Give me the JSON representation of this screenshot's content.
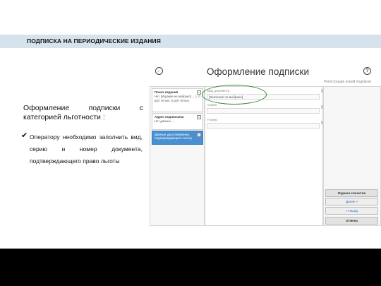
{
  "header": {
    "title": "ПОДПИСКА НА ПЕРИОДИЧЕСКИЕ ИЗДАНИЯ"
  },
  "lead": {
    "text": "Оформление подписки с категорией льготности :"
  },
  "bullet": {
    "text": "Оператору необходимо заполнить вид, серию и номер документа, подтверждающего право льготы"
  },
  "app": {
    "title": "Оформление подписки",
    "registration_label": "Регистрация новой подписки",
    "cards": [
      {
        "title": "Поиск издания",
        "body": "Нет. [Издание не выбрано] ... 1. 0 руб. 00 коп. 0 руб. 00 коп."
      },
      {
        "title": "Адрес подписчика",
        "body": "Нет данных ..."
      },
      {
        "title": "Данные удостоверения, подтверждающего льготу",
        "body": ""
      }
    ],
    "fields": [
      {
        "label": "Вид документа",
        "value": "[Значение не выбрано]"
      },
      {
        "label": "Серия",
        "value": ""
      },
      {
        "label": "Номер",
        "value": ""
      }
    ],
    "buttons": {
      "journal": "Журнал клиентов",
      "next": "Далее »",
      "back": "« Назад",
      "cancel": "Отмена"
    }
  }
}
